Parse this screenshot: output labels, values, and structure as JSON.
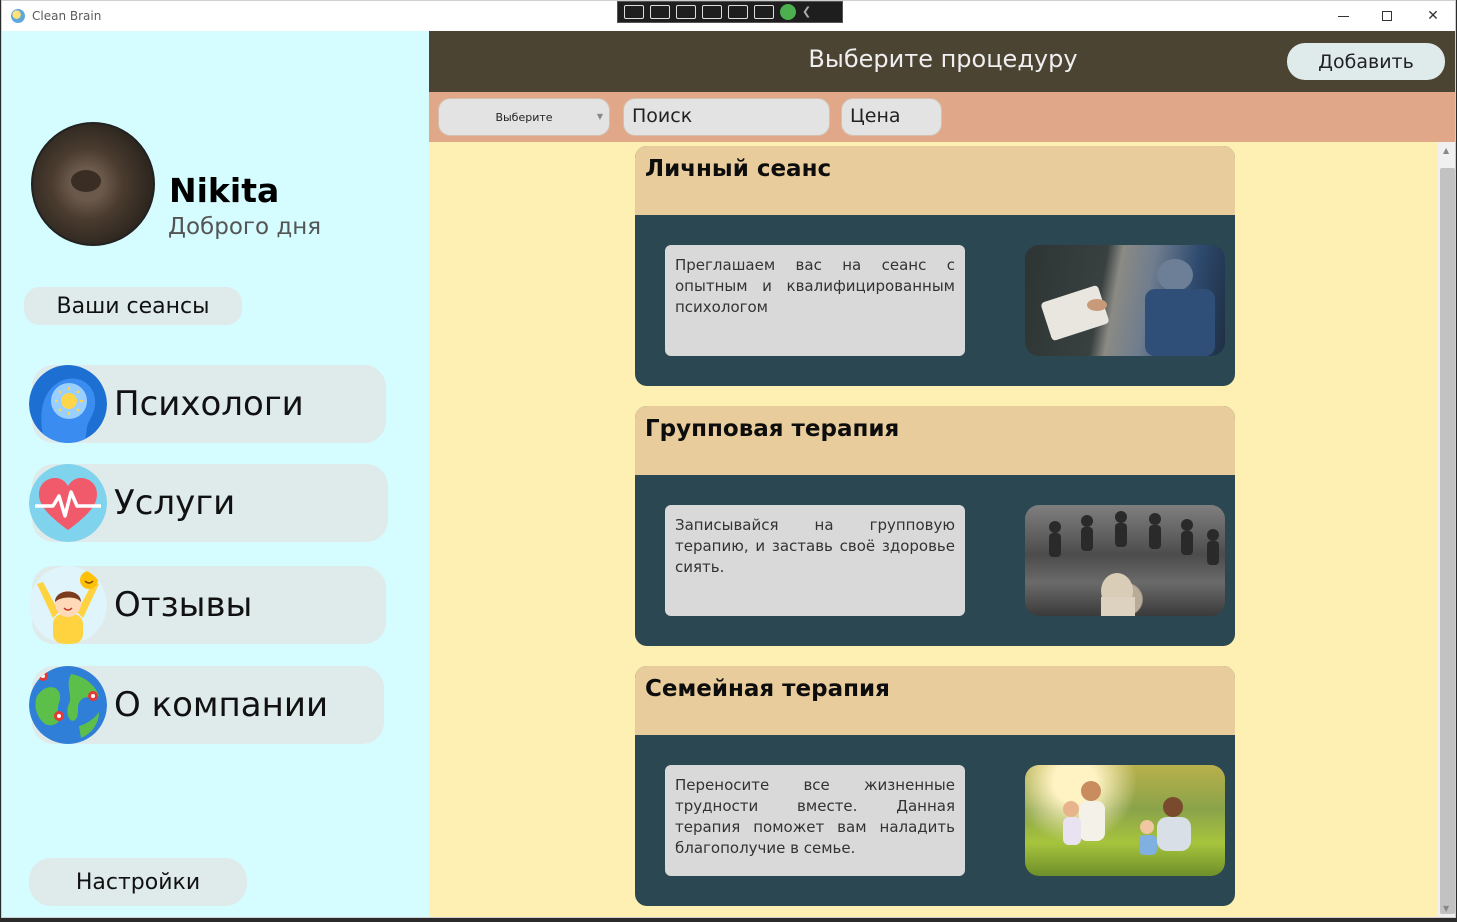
{
  "window": {
    "title": "Clean Brain"
  },
  "sidebar": {
    "user_name": "Nikita",
    "greeting": "Доброго дня",
    "sessions_label": "Ваши сеансы",
    "items": [
      {
        "label": "Психологи",
        "icon": "brain-icon"
      },
      {
        "label": "Услуги",
        "icon": "heart-pulse-icon"
      },
      {
        "label": "Отзывы",
        "icon": "happy-person-icon"
      },
      {
        "label": "О компании",
        "icon": "globe-pins-icon"
      }
    ],
    "settings_label": "Настройки"
  },
  "header": {
    "title": "Выберите процедуру",
    "add_label": "Добавить"
  },
  "filters": {
    "select_value": "Выберите",
    "search_placeholder": "Поиск",
    "price_placeholder": "Цена"
  },
  "cards": [
    {
      "title": "Личный сеанс",
      "description": "Преглашаем вас на сеанс с опытным и квалифицированным психологом",
      "image": "therapy-session-photo"
    },
    {
      "title": "Групповая терапия",
      "description": "Записывайся на групповую терапию, и заставь своё здоровье сиять.",
      "image": "group-therapy-photo"
    },
    {
      "title": "Семейная терапия",
      "description": "Переносите все жизненные трудности вместе. Данная терапия поможет вам наладить благополучие в семье.",
      "image": "family-photo"
    }
  ],
  "colors": {
    "sidebar_bg": "#d5fcfe",
    "header_bg": "#4b4433",
    "filter_bg": "#e0a888",
    "content_bg": "#fef0b2",
    "card_head": "#e8cc9c",
    "card_body": "#2a4752",
    "pill": "#dfeaeb"
  }
}
